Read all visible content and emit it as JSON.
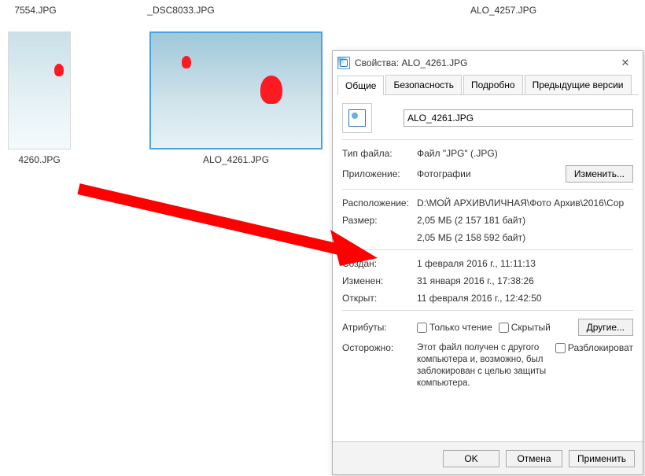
{
  "explorer": {
    "thumbs": [
      {
        "caption": "7554.JPG"
      },
      {
        "caption": "_DSC8033.JPG"
      },
      {
        "caption": "ALO_4257.JPG"
      },
      {
        "caption": "4260.JPG"
      },
      {
        "caption": "ALO_4261.JPG"
      }
    ]
  },
  "dialog": {
    "title": "Свойства: ALO_4261.JPG",
    "tabs": [
      "Общие",
      "Безопасность",
      "Подробно",
      "Предыдущие версии"
    ],
    "filename": "ALO_4261.JPG",
    "labels": {
      "filetype": "Тип файла:",
      "app": "Приложение:",
      "location": "Расположение:",
      "size": "Размер:",
      "ondisk": "",
      "created": "Создан:",
      "modified": "Изменен:",
      "accessed": "Открыт:",
      "attributes": "Атрибуты:",
      "security": "Осторожно:"
    },
    "values": {
      "filetype": "Файл \"JPG\" (.JPG)",
      "app": "Фотографии",
      "location": "D:\\МОЙ АРХИВ\\ЛИЧНАЯ\\Фото Архив\\2016\\Cop",
      "size": "2,05 МБ (2 157 181 байт)",
      "ondisk": "2,05 МБ (2 158 592 байт)",
      "created": "1 февраля 2016 г., 11:11:13",
      "modified": "31 января 2016 г., 17:38:26",
      "accessed": "11 февраля 2016 г., 12:42:50",
      "security": "Этот файл получен с другого компьютера и, возможно, был заблокирован с целью защиты компьютера."
    },
    "buttons": {
      "change": "Изменить...",
      "other": "Другие...",
      "ok": "OK",
      "cancel": "Отмена",
      "apply": "Применить"
    },
    "checkboxes": {
      "readonly": "Только чтение",
      "hidden": "Скрытый",
      "unblock": "Разблокироват"
    }
  }
}
